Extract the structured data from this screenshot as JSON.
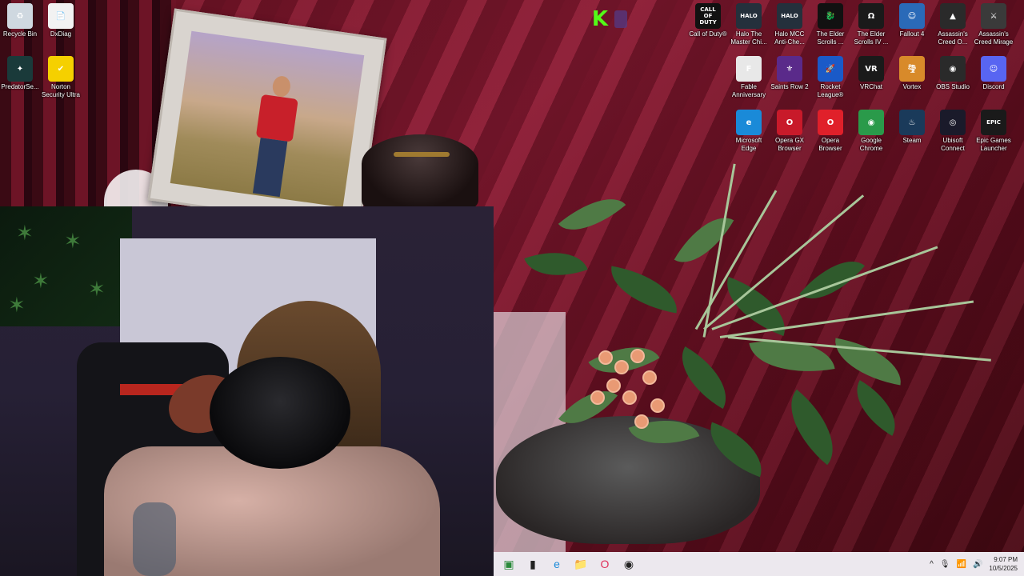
{
  "desktop": {
    "left_icons": [
      {
        "label": "Recycle Bin",
        "icon": "recycle-bin-icon",
        "glyph": "♻",
        "color": "#cfd8e0"
      },
      {
        "label": "DxDiag",
        "icon": "document-icon",
        "glyph": "📄",
        "color": "#f2f2f2"
      },
      {
        "label": "PredatorSe...",
        "icon": "predator-sense-icon",
        "glyph": "✦",
        "color": "#1a3a3a"
      },
      {
        "label": "Norton Security Ultra",
        "icon": "norton-icon",
        "glyph": "✔",
        "color": "#f5d000"
      }
    ],
    "right_icons": [
      {
        "label": "Call of Duty®",
        "icon": "call-of-duty-icon",
        "glyph": "CALL OF DUTY",
        "color": "#111111"
      },
      {
        "label": "Halo The Master Chi...",
        "icon": "halo-mcc-icon",
        "glyph": "HALO",
        "color": "#24303c"
      },
      {
        "label": "Halo MCC Anti-Che...",
        "icon": "halo-anticheat-icon",
        "glyph": "HALO",
        "color": "#24303c"
      },
      {
        "label": "The Elder Scrolls ...",
        "icon": "elder-scrolls-icon",
        "glyph": "🐉",
        "color": "#111111"
      },
      {
        "label": "The Elder Scrolls IV ...",
        "icon": "oblivion-icon",
        "glyph": "Ω",
        "color": "#1a1a1a"
      },
      {
        "label": "Fallout 4",
        "icon": "fallout-4-icon",
        "glyph": "☺",
        "color": "#2a6ab8"
      },
      {
        "label": "Assassin's Creed O...",
        "icon": "ac-odyssey-icon",
        "glyph": "▲",
        "color": "#2a2a2a"
      },
      {
        "label": "Assassin's Creed Mirage",
        "icon": "ac-mirage-icon",
        "glyph": "⚔",
        "color": "#3a3a3a"
      },
      {
        "label": "Fable Anniversary",
        "icon": "fable-icon",
        "glyph": "F",
        "color": "#e8e8e8"
      },
      {
        "label": "Saints Row 2",
        "icon": "saints-row-icon",
        "glyph": "⚜",
        "color": "#5a2a8a"
      },
      {
        "label": "Rocket League®",
        "icon": "rocket-league-icon",
        "glyph": "🚀",
        "color": "#1a5ac8"
      },
      {
        "label": "VRChat",
        "icon": "vrchat-icon",
        "glyph": "VR",
        "color": "#1a1a1a"
      },
      {
        "label": "Vortex",
        "icon": "vortex-icon",
        "glyph": "🌪",
        "color": "#d88a2a"
      },
      {
        "label": "OBS Studio",
        "icon": "obs-icon",
        "glyph": "◉",
        "color": "#2a2a2a"
      },
      {
        "label": "Discord",
        "icon": "discord-icon",
        "glyph": "☺",
        "color": "#5865f2"
      },
      {
        "label": "Microsoft Edge",
        "icon": "edge-icon",
        "glyph": "e",
        "color": "#1a8ad8"
      },
      {
        "label": "Opera GX Browser",
        "icon": "opera-gx-icon",
        "glyph": "O",
        "color": "#c81a2a"
      },
      {
        "label": "Opera Browser",
        "icon": "opera-icon",
        "glyph": "O",
        "color": "#e0202a"
      },
      {
        "label": "Google Chrome",
        "icon": "chrome-icon",
        "glyph": "◉",
        "color": "#2a9a4a"
      },
      {
        "label": "Steam",
        "icon": "steam-icon",
        "glyph": "♨",
        "color": "#1a3a5a"
      },
      {
        "label": "Ubisoft Connect",
        "icon": "ubisoft-icon",
        "glyph": "◎",
        "color": "#1a1a2a"
      },
      {
        "label": "Epic Games Launcher",
        "icon": "epic-games-icon",
        "glyph": "EPIC",
        "color": "#1a1a1a"
      }
    ],
    "overlay_logo": {
      "text": "K",
      "icon": "kick-logo-icon",
      "color": "#53fc18"
    }
  },
  "taskbar": {
    "items": [
      {
        "icon": "window-thumbnail-icon",
        "glyph": "▣",
        "color": "#2a8a3a"
      },
      {
        "icon": "terminal-icon",
        "glyph": "▮",
        "color": "#222222"
      },
      {
        "icon": "edge-taskbar-icon",
        "glyph": "e",
        "color": "#1a8ad8"
      },
      {
        "icon": "file-explorer-icon",
        "glyph": "📁",
        "color": "#f0c030"
      },
      {
        "icon": "opera-gx-taskbar-icon",
        "glyph": "O",
        "color": "#e0305a"
      },
      {
        "icon": "obs-taskbar-icon",
        "glyph": "◉",
        "color": "#222222"
      }
    ],
    "tray": {
      "chevron": "^",
      "time": "9:07 PM",
      "date": "10/5/2025"
    }
  }
}
